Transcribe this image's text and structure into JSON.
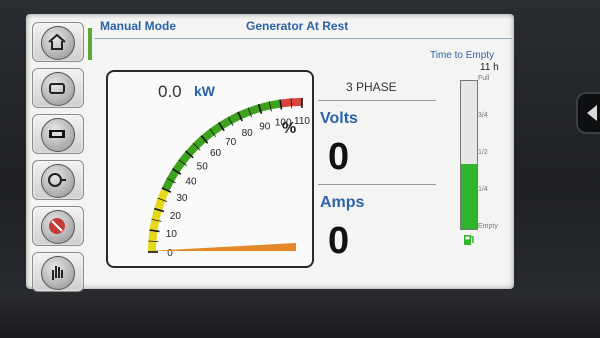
{
  "header": {
    "mode": "Manual Mode",
    "status": "Generator At Rest"
  },
  "left_buttons": [
    {
      "icon": "home-icon"
    },
    {
      "icon": "engine-icon"
    },
    {
      "icon": "battery-icon"
    },
    {
      "icon": "alternator-icon"
    },
    {
      "icon": "stop-icon"
    },
    {
      "icon": "hand-icon"
    }
  ],
  "power": {
    "value": "0.0",
    "unit": "kW",
    "percent_symbol": "%",
    "load_percent": 0,
    "scale_labels": [
      "0",
      "10",
      "20",
      "30",
      "40",
      "50",
      "60",
      "70",
      "80",
      "90",
      "100",
      "110"
    ]
  },
  "electrical": {
    "phase": "3 PHASE",
    "volts_label": "Volts",
    "volts_value": "0",
    "amps_label": "Amps",
    "amps_value": "0"
  },
  "fuel": {
    "time_to_empty_label": "Time to Empty",
    "time_to_empty_value": "11 h",
    "level_fraction": 0.44,
    "marks": [
      "Full",
      "3/4",
      "1/2",
      "1/4",
      "Empty"
    ]
  },
  "colors": {
    "accent": "#2b62a8",
    "gauge_green": "#3fa21c",
    "gauge_yellow": "#e6d81a",
    "gauge_red": "#d9443e",
    "load_bar": "#e08a2a",
    "fuel_green": "#2fb52a"
  }
}
